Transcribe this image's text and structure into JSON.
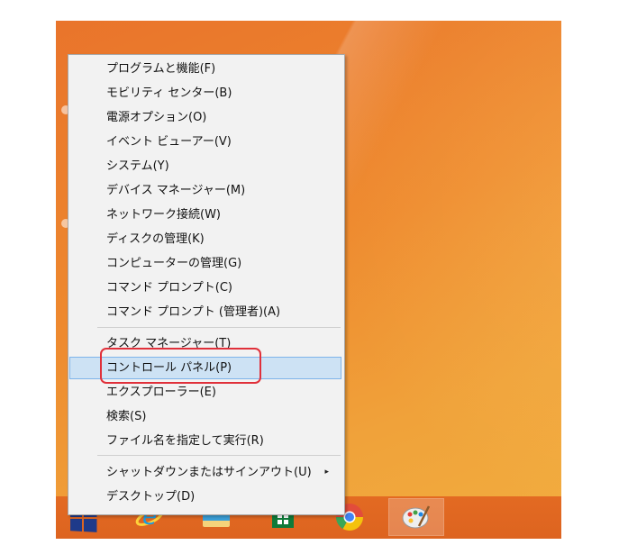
{
  "menu": {
    "items": [
      {
        "label": "プログラムと機能(F)"
      },
      {
        "label": "モビリティ センター(B)"
      },
      {
        "label": "電源オプション(O)"
      },
      {
        "label": "イベント ビューアー(V)"
      },
      {
        "label": "システム(Y)"
      },
      {
        "label": "デバイス マネージャー(M)"
      },
      {
        "label": "ネットワーク接続(W)"
      },
      {
        "label": "ディスクの管理(K)"
      },
      {
        "label": "コンピューターの管理(G)"
      },
      {
        "label": "コマンド プロンプト(C)"
      },
      {
        "label": "コマンド プロンプト (管理者)(A)"
      },
      {
        "label": "タスク マネージャー(T)"
      },
      {
        "label": "コントロール パネル(P)"
      },
      {
        "label": "エクスプローラー(E)"
      },
      {
        "label": "検索(S)"
      },
      {
        "label": "ファイル名を指定して実行(R)"
      },
      {
        "label": "シャットダウンまたはサインアウト(U)"
      },
      {
        "label": "デスクトップ(D)"
      }
    ],
    "highlighted_item": "コントロール パネル(P)",
    "submenu_arrow": "▸"
  },
  "taskbar": {
    "icons": [
      "windows-logo-icon",
      "internet-explorer-icon",
      "file-explorer-icon",
      "store-icon",
      "chrome-icon",
      "paint-icon"
    ]
  },
  "colors": {
    "desktop": "#ee8a2f",
    "taskbar": "#e06722",
    "menu_bg": "#f2f2f2",
    "hover_bg": "#cde2f4",
    "annotation_red": "#e0303a"
  }
}
